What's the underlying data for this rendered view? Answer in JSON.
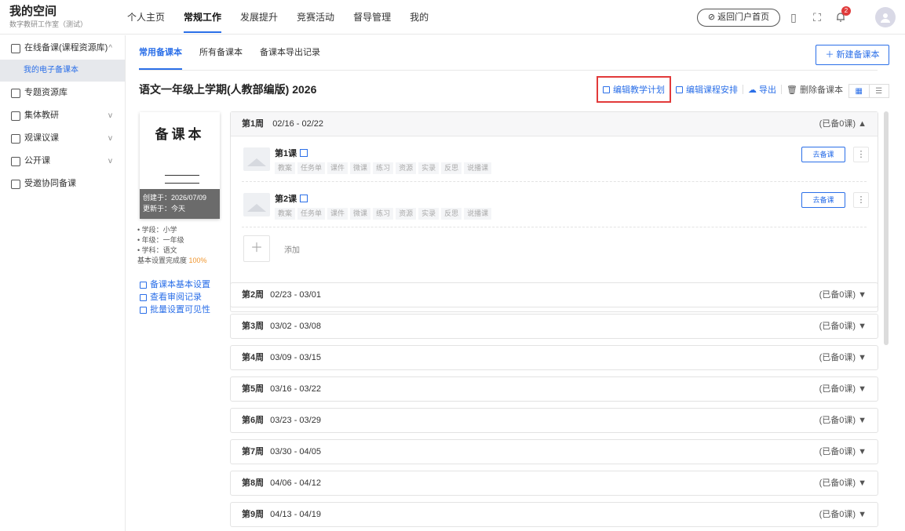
{
  "brand": {
    "title": "我的空间",
    "subtitle": "数字教研工作室（测试）"
  },
  "nav": [
    "个人主页",
    "常规工作",
    "发展提升",
    "竞赛活动",
    "督导管理",
    "我的"
  ],
  "nav_active": "常规工作",
  "header": {
    "portal_button": "返回门户首页",
    "notification_count": "2"
  },
  "sidebar": {
    "items": [
      {
        "label": "在线备课(课程资源库)",
        "icon": "book-icon",
        "chevron": "^"
      },
      {
        "label": "专题资源库",
        "icon": "folder-icon",
        "chevron": ""
      },
      {
        "label": "集体教研",
        "icon": "group-icon",
        "chevron": "v"
      },
      {
        "label": "观课议课",
        "icon": "screen-icon",
        "chevron": "v"
      },
      {
        "label": "公开课",
        "icon": "presentation-icon",
        "chevron": "v"
      },
      {
        "label": "受邀协同备课",
        "icon": "people-icon",
        "chevron": ""
      }
    ],
    "sub_item": "我的电子备课本"
  },
  "tabs": [
    "常用备课本",
    "所有备课本",
    "备课本导出记录"
  ],
  "new_button": "＋ 新建备课本",
  "book": {
    "title": "语文一年级上学期(人教部编版) 2026",
    "cover_name": "备课本",
    "created": "创建于：2026/07/09",
    "updated": "更新于：今天",
    "stage": "• 学段：小学",
    "grade": "• 年级：一年级",
    "subject": "• 学科：语文",
    "completion_label": "基本设置完成度",
    "completion_value": "100%"
  },
  "actions": {
    "edit_plan": "编辑教学计划",
    "edit_schedule": "编辑课程安排",
    "export": "导出",
    "delete": "删除备课本"
  },
  "side_links": [
    "备课本基本设置",
    "查看审阅记录",
    "批量设置可见性"
  ],
  "open_week": {
    "label": "第1周",
    "range": "02/16 - 02/22",
    "status": "(已备0课) ▲",
    "lessons": [
      {
        "title": "第1课",
        "button": "去备课"
      },
      {
        "title": "第2课",
        "button": "去备课"
      }
    ],
    "tags": [
      "教案",
      "任务单",
      "课件",
      "微课",
      "练习",
      "资源",
      "实录",
      "反思",
      "说播课"
    ],
    "add_label": "添加"
  },
  "weeks": [
    {
      "label": "第2周",
      "range": "02/23 - 03/01",
      "status": "(已备0课) ▼"
    },
    {
      "label": "第3周",
      "range": "03/02 - 03/08",
      "status": "(已备0课) ▼"
    },
    {
      "label": "第4周",
      "range": "03/09 - 03/15",
      "status": "(已备0课) ▼"
    },
    {
      "label": "第5周",
      "range": "03/16 - 03/22",
      "status": "(已备0课) ▼"
    },
    {
      "label": "第6周",
      "range": "03/23 - 03/29",
      "status": "(已备0课) ▼"
    },
    {
      "label": "第7周",
      "range": "03/30 - 04/05",
      "status": "(已备0课) ▼"
    },
    {
      "label": "第8周",
      "range": "04/06 - 04/12",
      "status": "(已备0课) ▼"
    },
    {
      "label": "第9周",
      "range": "04/13 - 04/19",
      "status": "(已备0课) ▼"
    }
  ],
  "colors": {
    "accent": "#2b6fe8",
    "highlight_box": "#e23a3a",
    "badge": "#e03b3b",
    "completion": "#f0962e"
  }
}
